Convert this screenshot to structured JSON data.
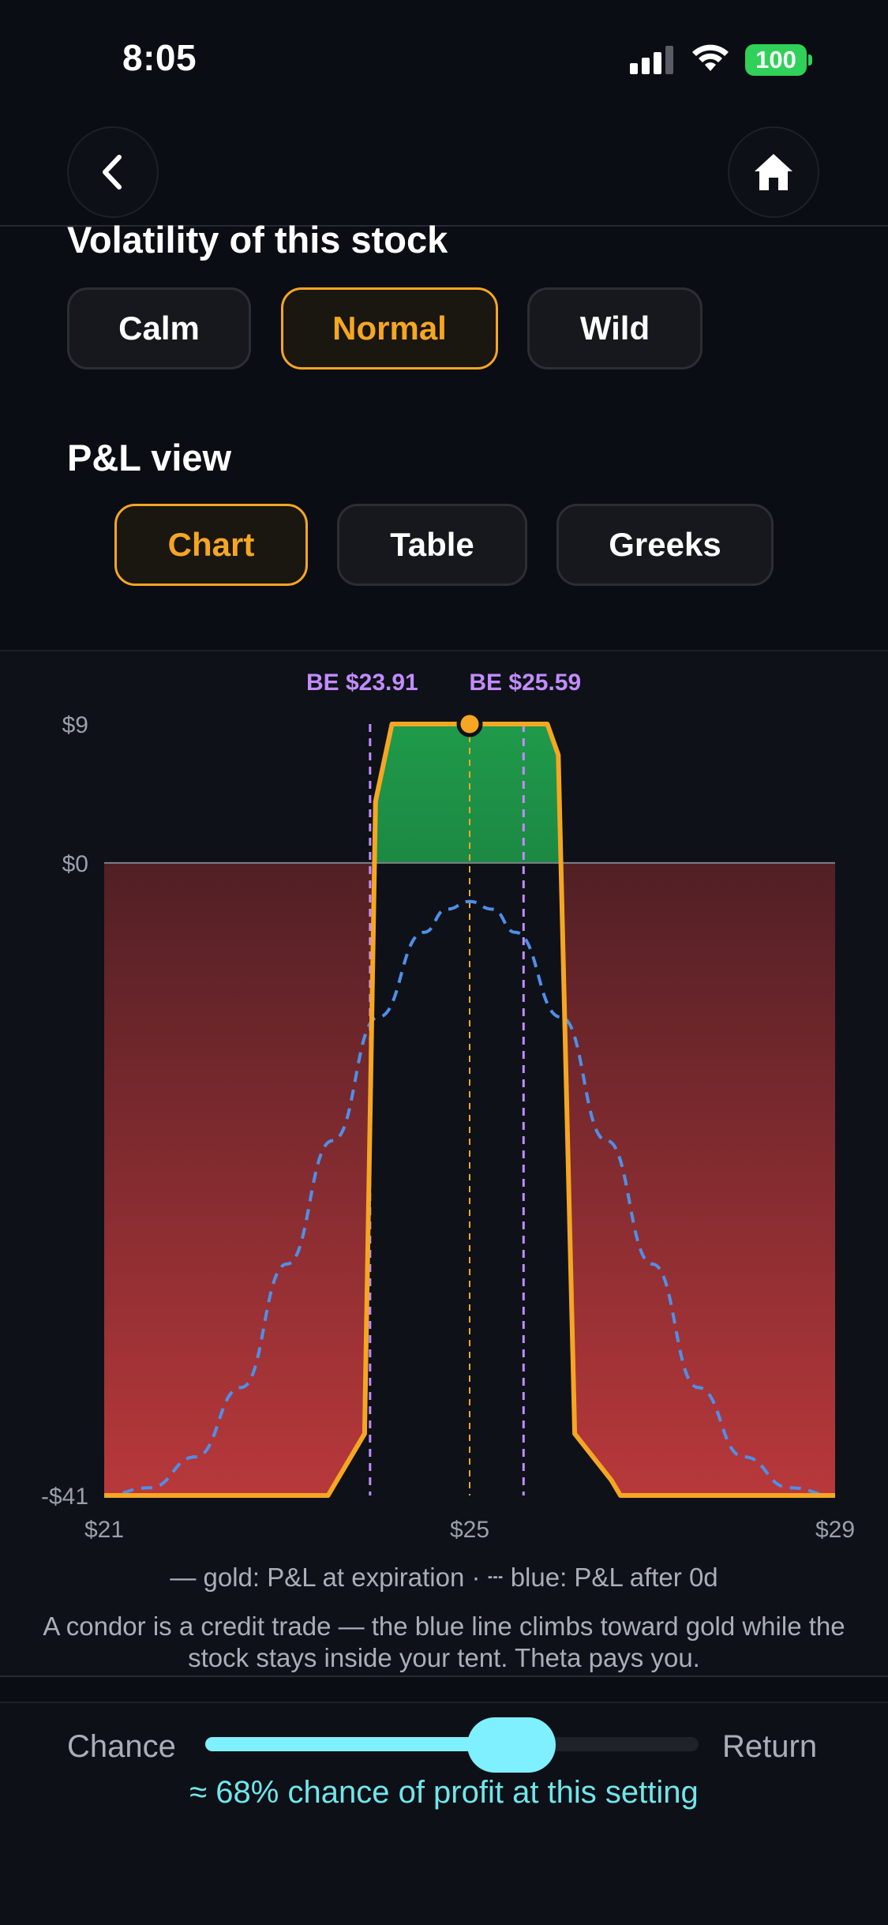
{
  "status_bar": {
    "time": "8:05",
    "battery": "100"
  },
  "nav": {
    "back_icon": "chevron-left-icon",
    "home_icon": "home-icon"
  },
  "volatility": {
    "title": "Volatility of this stock",
    "options": [
      "Calm",
      "Normal",
      "Wild"
    ],
    "selected": "Normal"
  },
  "pl_view": {
    "title": "P&L view",
    "options": [
      "Chart",
      "Table",
      "Greeks"
    ],
    "selected": "Chart"
  },
  "colors": {
    "accent": "#f5a623",
    "profit": "#1f9a4a",
    "loss": "#b8383b",
    "breakeven": "#c28cff",
    "theoretical": "#4f8fe8",
    "slider": "#7ff0ff"
  },
  "chart_data": {
    "type": "line",
    "ylim": [
      -41,
      9
    ],
    "xlim": [
      21,
      29
    ],
    "y_ticks": [
      "$9",
      "$0",
      "-$41"
    ],
    "x_ticks": [
      "$21",
      "$25",
      "$29"
    ],
    "breakevens": [
      {
        "label": "BE $23.91",
        "x": 23.91
      },
      {
        "label": "BE $25.59",
        "x": 25.59
      }
    ],
    "current_price": 25,
    "series": [
      {
        "name": "P&L at expiration",
        "x": [
          21,
          23.45,
          23.85,
          23.97,
          24.15,
          25,
          25.85,
          25.97,
          26.15,
          26.55,
          26.65,
          29
        ],
        "y": [
          -41,
          -41,
          -37,
          4,
          9,
          9,
          9,
          7,
          -37,
          -40,
          -41,
          -41
        ]
      },
      {
        "name": "P&L after 0d",
        "x": [
          21,
          21.5,
          22,
          22.5,
          23,
          23.5,
          24,
          24.5,
          24.75,
          25,
          25.25,
          25.5,
          26,
          26.5,
          27,
          27.5,
          28,
          28.5,
          29
        ],
        "y": [
          -41,
          -40.5,
          -38.5,
          -34,
          -26,
          -18,
          -10,
          -4.5,
          -3,
          -2.5,
          -3,
          -4.5,
          -10,
          -18,
          -26,
          -34,
          -38.5,
          -40.5,
          -41
        ]
      }
    ]
  },
  "legend_text": "— gold: P&L at expiration · ┄ blue: P&L after 0d",
  "explanation": "A condor is a credit trade — the blue line climbs toward gold while the stock stays inside your tent. Theta pays you.",
  "slider": {
    "left_label": "Chance",
    "right_label": "Return",
    "value": 0.62
  },
  "probability_text": "≈ 68% chance of profit at this setting"
}
